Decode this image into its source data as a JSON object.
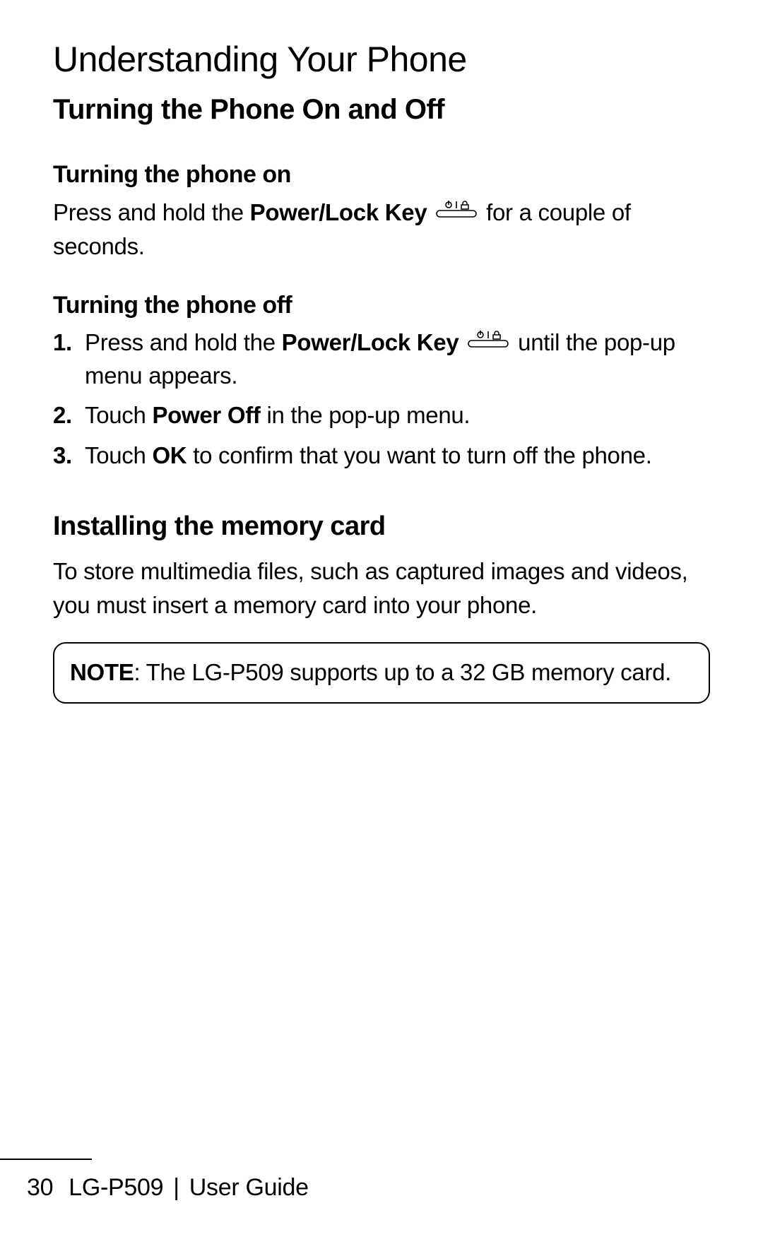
{
  "heading_main": "Understanding Your Phone",
  "heading_sub": "Turning the Phone On and Off",
  "section_on": {
    "title": "Turning the phone on",
    "para_pre": "Press and hold the ",
    "key_label": "Power/Lock Key",
    "para_post": " for a couple of seconds."
  },
  "section_off": {
    "title": "Turning the phone off",
    "items": [
      {
        "num": "1.",
        "pre": "Press and hold the ",
        "key_label": "Power/Lock Key",
        "post": " until the pop-up menu appears."
      },
      {
        "num": "2.",
        "pre": "Touch ",
        "bold": "Power Off",
        "post": " in the pop-up menu."
      },
      {
        "num": "3.",
        "pre": "Touch ",
        "bold": "OK",
        "post": " to confirm that you want to turn off the phone."
      }
    ]
  },
  "section_memory": {
    "title": "Installing the memory card",
    "para": "To store multimedia files, such as captured images and videos, you must insert a memory card into your phone.",
    "note_label": "NOTE",
    "note_text": ": The LG-P509 supports up to a 32 GB memory card."
  },
  "footer": {
    "page": "30",
    "model": "LG-P509",
    "sep": "|",
    "title": "User Guide"
  }
}
